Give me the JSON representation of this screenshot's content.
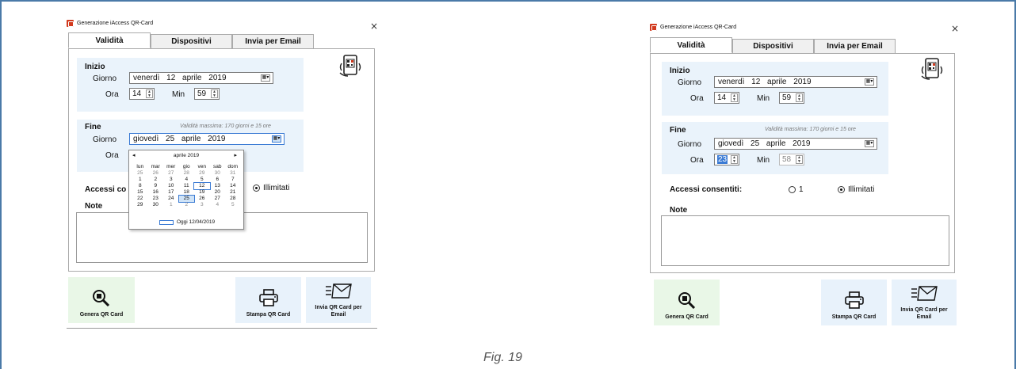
{
  "left": {
    "title": "Generazione iAccess QR-Card",
    "close": "×",
    "tabs": [
      "Validità",
      "Dispositivi",
      "Invia per Email"
    ],
    "inizio": {
      "heading": "Inizio",
      "giorno_label": "Giorno",
      "date": "venerdì 12 aprile 2019",
      "ora_label": "Ora",
      "ora": "14",
      "min_label": "Min",
      "min": "59"
    },
    "fine": {
      "heading": "Fine",
      "hint": "Validità massima: 170 giorni e 15 ore",
      "giorno_label": "Giorno",
      "date": "giovedì 25 aprile 2019",
      "ora_label": "Ora"
    },
    "accessi_label": "Accessi co",
    "radio_illimitati": "Illimitati",
    "note_label": "Note",
    "buttons": {
      "genera": "Genera QR Card",
      "stampa": "Stampa QR Card",
      "invia": "Invia QR Card per Email"
    }
  },
  "calendar": {
    "month": "aprile 2019",
    "prev": "◂",
    "next": "▸",
    "weekdays": [
      "lun",
      "mar",
      "mer",
      "gio",
      "ven",
      "sab",
      "dom"
    ],
    "days": [
      "25",
      "26",
      "27",
      "28",
      "29",
      "30",
      "31",
      "1",
      "2",
      "3",
      "4",
      "5",
      "6",
      "7",
      "8",
      "9",
      "10",
      "11",
      "12",
      "13",
      "14",
      "15",
      "16",
      "17",
      "18",
      "19",
      "20",
      "21",
      "22",
      "23",
      "24",
      "25",
      "26",
      "27",
      "28",
      "29",
      "30",
      "1",
      "2",
      "3",
      "4",
      "5"
    ],
    "today_label": "Oggi 12/04/2019"
  },
  "right": {
    "title": "Generazione iAccess QR-Card",
    "close": "×",
    "tabs": [
      "Validità",
      "Dispositivi",
      "Invia per Email"
    ],
    "inizio": {
      "heading": "Inizio",
      "giorno_label": "Giorno",
      "date": "venerdì 12 aprile 2019",
      "ora_label": "Ora",
      "ora": "14",
      "min_label": "Min",
      "min": "59"
    },
    "fine": {
      "heading": "Fine",
      "hint": "Validità massima: 170 giorni e 15 ore",
      "giorno_label": "Giorno",
      "date": "giovedì 25 aprile 2019",
      "ora_label": "Ora",
      "ora": "23",
      "min_label": "Min",
      "min": "58"
    },
    "accessi_label": "Accessi consentiti:",
    "radio_1": "1",
    "radio_illimitati": "Illimitati",
    "note_label": "Note",
    "buttons": {
      "genera": "Genera QR Card",
      "stampa": "Stampa QR Card",
      "invia": "Invia QR Card per Email"
    }
  },
  "figure_caption": "Fig. 19"
}
